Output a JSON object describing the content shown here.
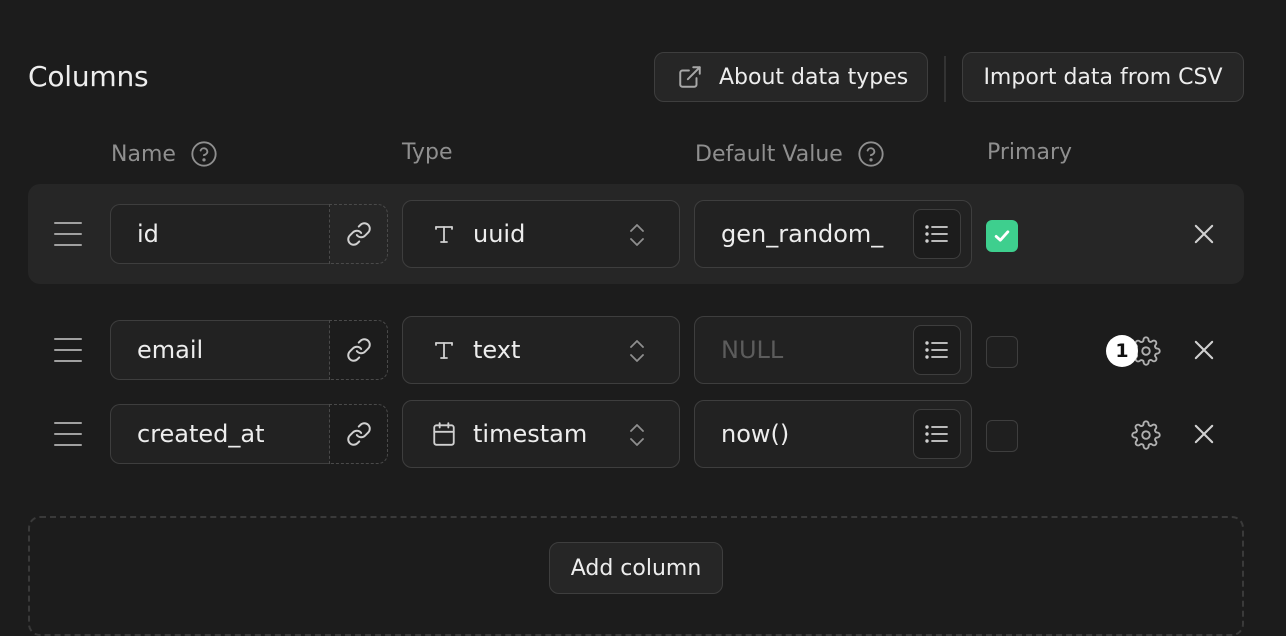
{
  "section": {
    "title": "Columns"
  },
  "toolbar": {
    "about_label": "About data types",
    "about_icon": "external-link-icon",
    "import_label": "Import data from CSV"
  },
  "headers": {
    "name": "Name",
    "type": "Type",
    "default_value": "Default Value",
    "primary": "Primary"
  },
  "columns": [
    {
      "name": "id",
      "type": "uuid",
      "type_icon": "text-type-icon",
      "default_value": "gen_random_",
      "default_placeholder": "",
      "primary": true,
      "has_settings": false
    },
    {
      "name": "email",
      "type": "text",
      "type_icon": "text-type-icon",
      "default_value": "",
      "default_placeholder": "NULL",
      "primary": false,
      "has_settings": true
    },
    {
      "name": "created_at",
      "type": "timestam",
      "type_icon": "calendar-icon",
      "default_value": "now()",
      "default_placeholder": "",
      "primary": false,
      "has_settings": true
    }
  ],
  "badge": {
    "count": "1"
  },
  "add_column_label": "Add column",
  "colors": {
    "background": "#1c1c1c",
    "accent": "#3ecf8e",
    "border": "#3e3e3e"
  }
}
